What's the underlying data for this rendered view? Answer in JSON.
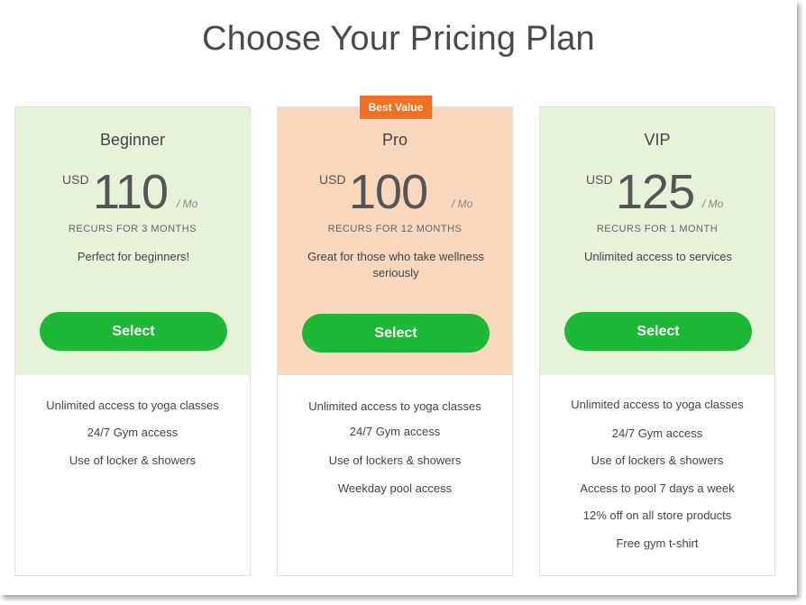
{
  "page": {
    "title": "Choose Your Pricing Plan"
  },
  "colors": {
    "button": "#1cb836",
    "badge": "#f36f21",
    "green_bg": "#e6f3d8",
    "orange_bg": "#f8d7bd"
  },
  "plans": [
    {
      "name": "Beginner",
      "currency": "USD",
      "amount": "110",
      "per": "/ Mo",
      "recurs": "RECURS FOR 3 MONTHS",
      "description": "Perfect for beginners!",
      "button": "Select",
      "features": [
        "Unlimited access to yoga classes",
        "24/7 Gym access",
        "Use of locker & showers"
      ]
    },
    {
      "name": "Pro",
      "badge": "Best Value",
      "currency": "USD",
      "amount": "100",
      "per": "/ Mo",
      "recurs": "RECURS FOR 12 MONTHS",
      "description": "Great for those who take wellness seriously",
      "button": "Select",
      "features": [
        "Unlimited access to yoga classes",
        "24/7 Gym access",
        "Use of lockers & showers",
        "Weekday pool access"
      ]
    },
    {
      "name": "VIP",
      "currency": "USD",
      "amount": "125",
      "per": "/ Mo",
      "recurs": "RECURS FOR 1 MONTH",
      "description": "Unlimited access to services",
      "button": "Select",
      "features": [
        "Unlimited access to yoga classes",
        "24/7 Gym access",
        "Use of lockers & showers",
        "Access to pool 7 days a week",
        "12% off on all store products",
        "Free gym t-shirt"
      ]
    }
  ]
}
